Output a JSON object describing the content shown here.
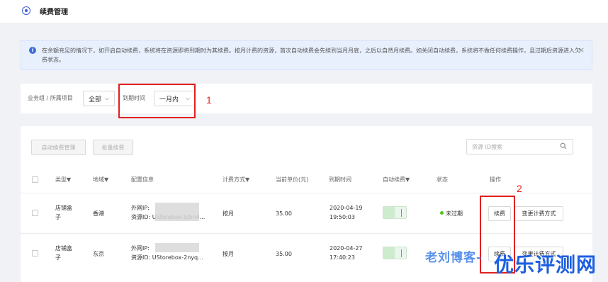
{
  "header": {
    "title": "续费管理",
    "icon": "target-icon"
  },
  "alert": {
    "text": "在余额充足的情况下，如开启自动续费，系统将在资源即将到期时为其续费。按月计费的资源，首次自动续费会先续到当月月底，之后以自然月续费。如关闭自动续费，系统将不做任何续费操作，且过期后资源进入欠费状态。",
    "close": "×"
  },
  "filter": {
    "group_label": "业务组 / 所属项目",
    "group_value": "全部",
    "expire_label": "到期时间",
    "expire_value": "一月内"
  },
  "annotations": {
    "one": "1",
    "two": "2"
  },
  "toolbar": {
    "auto_renew_btn": "自动续费管理",
    "batch_renew_btn": "批量续费",
    "search_placeholder": "资源 ID搜索"
  },
  "table": {
    "headers": [
      "类型▼",
      "地域▼",
      "配置信息",
      "计费方式▼",
      "当前单价(元)",
      "到期时间",
      "自动续费▼",
      "状态",
      "操作"
    ],
    "rows": [
      {
        "type": "店铺盒子",
        "region": "香港",
        "config_ip": "外网IP:",
        "config_id": "资源ID: UStorebox-lp5n4...",
        "billing": "按月",
        "price": "35.00",
        "expire_date": "2020-04-19",
        "expire_time": "19:50:03",
        "status": "未过期",
        "renew_btn": "续费",
        "change_btn": "变更计费方式"
      },
      {
        "type": "店铺盒子",
        "region": "东京",
        "config_ip": "外网IP:",
        "config_id": "资源ID: UStorebox-2nyq...",
        "billing": "按月",
        "price": "35.00",
        "expire_date": "2020-04-27",
        "expire_time": "17:40:23",
        "renew_btn": "续费",
        "change_btn": "变更计费方式"
      }
    ]
  },
  "watermarks": {
    "left": "老刘博客-",
    "right": "优乐评测网"
  },
  "colors": {
    "accent": "#3b5bdb",
    "annotation": "#e02020",
    "status_ok": "#52c41a"
  }
}
